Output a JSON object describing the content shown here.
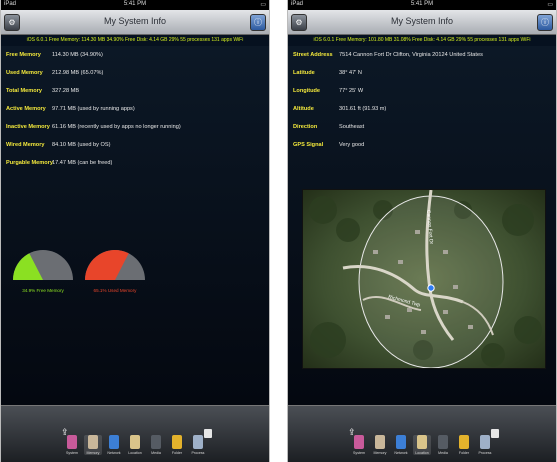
{
  "status": {
    "carrier": "iPad",
    "time": "5:41 PM",
    "battery": "",
    "time_right": "5:41 PM"
  },
  "left": {
    "title": "My System Info",
    "infobar": "iOS 6.0.1   Free Memory: 114.30 MB 34.90%   Free Disk: 4.14 GB 29%   55 processes   131 apps   WiFi",
    "rows": [
      {
        "label": "Free Memory",
        "value": "114.30 MB (34.90%)"
      },
      {
        "label": "Used Memory",
        "value": "212.98 MB (65.07%)"
      },
      {
        "label": "Total Memory",
        "value": "327.28 MB"
      },
      {
        "label": "Active Memory",
        "value": "97.71 MB (used by running apps)"
      },
      {
        "label": "Inactive Memory",
        "value": "61.16 MB (recently used by apps no longer running)"
      },
      {
        "label": "Wired Memory",
        "value": "84.10 MB (used by OS)"
      },
      {
        "label": "Purgable Memory",
        "value": "17.47 MB (can be freed)"
      }
    ],
    "gauges": [
      {
        "label": "34.9% Free Memory",
        "percent": 34.9,
        "fill": "#8be022",
        "text_color": "#8be022"
      },
      {
        "label": "65.1% Used Memory",
        "percent": 65.1,
        "fill": "#e8452a",
        "text_color": "#e8452a"
      }
    ]
  },
  "right": {
    "title": "My System Info",
    "infobar": "iOS 6.0.1   Free Memory: 101.80 MB 31.08%   Free Disk: 4.14 GB 29%   55 processes   131 apps   WiFi",
    "rows": [
      {
        "label": "Street Address",
        "value": "7514 Cannon Fort Dr Clifton, Virginia 20124 United States"
      },
      {
        "label": "Latitude",
        "value": "38° 47' N"
      },
      {
        "label": "Longitude",
        "value": "77° 25' W"
      },
      {
        "label": "Altitude",
        "value": "301.61 ft (91.93 m)"
      },
      {
        "label": "Direction",
        "value": "Southeast"
      },
      {
        "label": "GPS Signal",
        "value": "Very good"
      }
    ],
    "map": {
      "road_label": "Cannon Fort Dr",
      "road_label_2": "Richmond Twp"
    }
  },
  "tabs": [
    "System",
    "Memory",
    "Network",
    "Location",
    "Media",
    "Folder",
    "Process"
  ],
  "left_selected_tab": "Memory",
  "right_selected_tab": "Location",
  "colors": {
    "accent_label": "#f5ea3c",
    "infobar_text": "#d6f01f",
    "background": "#04070f"
  }
}
